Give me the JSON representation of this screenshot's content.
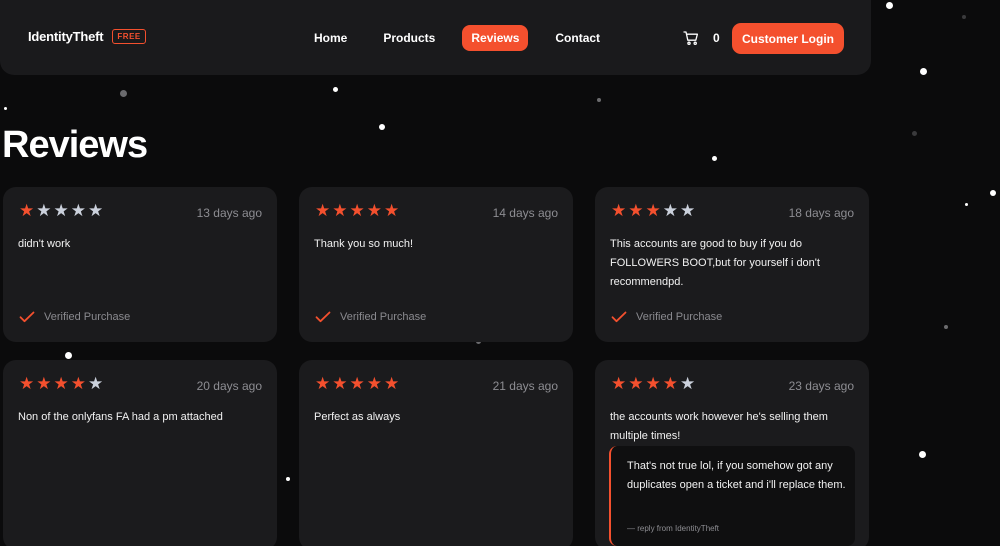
{
  "nav": {
    "brand": "IdentityTheft",
    "badge": "FREE",
    "links": [
      {
        "label": "Home",
        "active": false
      },
      {
        "label": "Products",
        "active": false
      },
      {
        "label": "Reviews",
        "active": true
      },
      {
        "label": "Contact",
        "active": false
      }
    ],
    "cart_icon": "cart-icon",
    "cart_count": "0",
    "login_label": "Customer Login"
  },
  "page": {
    "title": "Reviews"
  },
  "colors": {
    "accent": "#f4502e",
    "star_off": "#cbd1dc",
    "card_bg": "#1b1b1d",
    "page_bg": "#0b0b0c"
  },
  "reviews": [
    {
      "rating": 1,
      "date": "13 days ago",
      "text": "didn't work",
      "verified": "Verified Purchase"
    },
    {
      "rating": 5,
      "date": "14 days ago",
      "text": "Thank you so much!",
      "verified": "Verified Purchase"
    },
    {
      "rating": 3,
      "date": "18 days ago",
      "text": "This accounts are good to buy if you do FOLLOWERS BOOT,but for yourself i don't recommendpd.",
      "verified": "Verified Purchase"
    },
    {
      "rating": 4,
      "date": "20 days ago",
      "text": "Non of the onlyfans FA had a pm attached"
    },
    {
      "rating": 5,
      "date": "21 days ago",
      "text": "Perfect as always"
    },
    {
      "rating": 4,
      "date": "23 days ago",
      "text": "the accounts work however he's selling them multiple times!",
      "reply": {
        "text": "That's not true lol, if you somehow got any duplicates open a ticket and i'll replace them.",
        "from": "— reply from IdentityTheft"
      }
    }
  ]
}
